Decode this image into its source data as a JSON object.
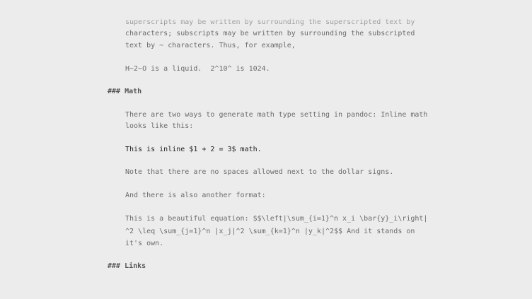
{
  "editor": {
    "lines": [
      "superscripts may be written by surrounding the superscripted text by",
      "characters; subscripts may be written by surrounding the subscripted",
      "text by ~ characters. Thus, for example,",
      "H~2~O is a liquid.  2^10^ is 1024.",
      "### Math",
      "There are two ways to generate math type setting in pandoc: Inline math",
      "looks like this:",
      "This is inline $1 + 2 = 3$ math.",
      "Note that there are no spaces allowed next to the dollar signs.",
      "And there is also another format:",
      "This is a beautiful equation: $$\\left|\\sum_{i=1}^n x_i \\bar{y}_i\\right|",
      "^2 \\leq \\sum_{j=1}^n |x_j|^2 \\sum_{k=1}^n |y_k|^2$$ And it stands on",
      "it's own.",
      "### Links"
    ]
  }
}
